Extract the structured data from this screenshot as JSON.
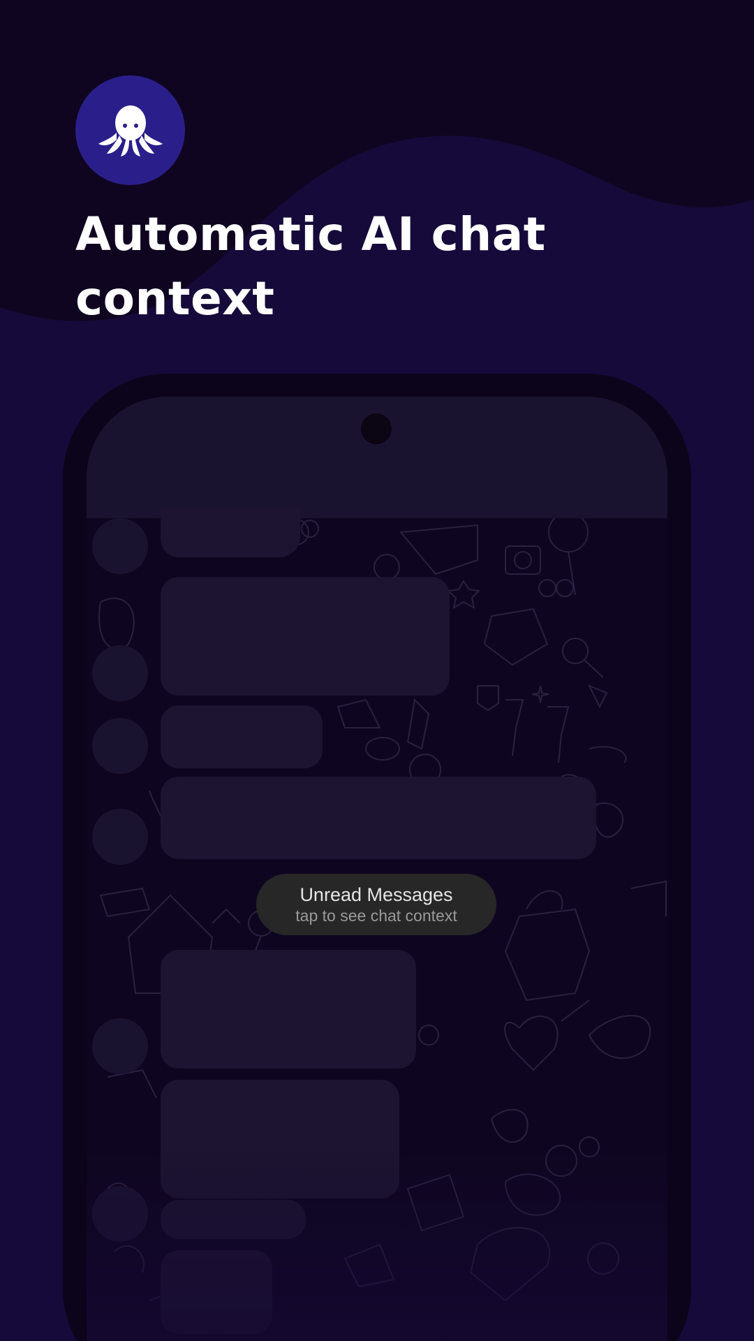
{
  "colors": {
    "background_dark": "#0f0520",
    "background_wave": "#160a3a",
    "logo_circle": "#2a1f8a",
    "bubble": "#1c1430",
    "pill": "#272727"
  },
  "brand": {
    "logo_icon": "octopus-icon"
  },
  "headline": {
    "line1": "Automatic AI chat",
    "line2": "context"
  },
  "chat": {
    "unread_pill": {
      "title": "Unread Messages",
      "subtitle": "tap to see chat context"
    }
  }
}
